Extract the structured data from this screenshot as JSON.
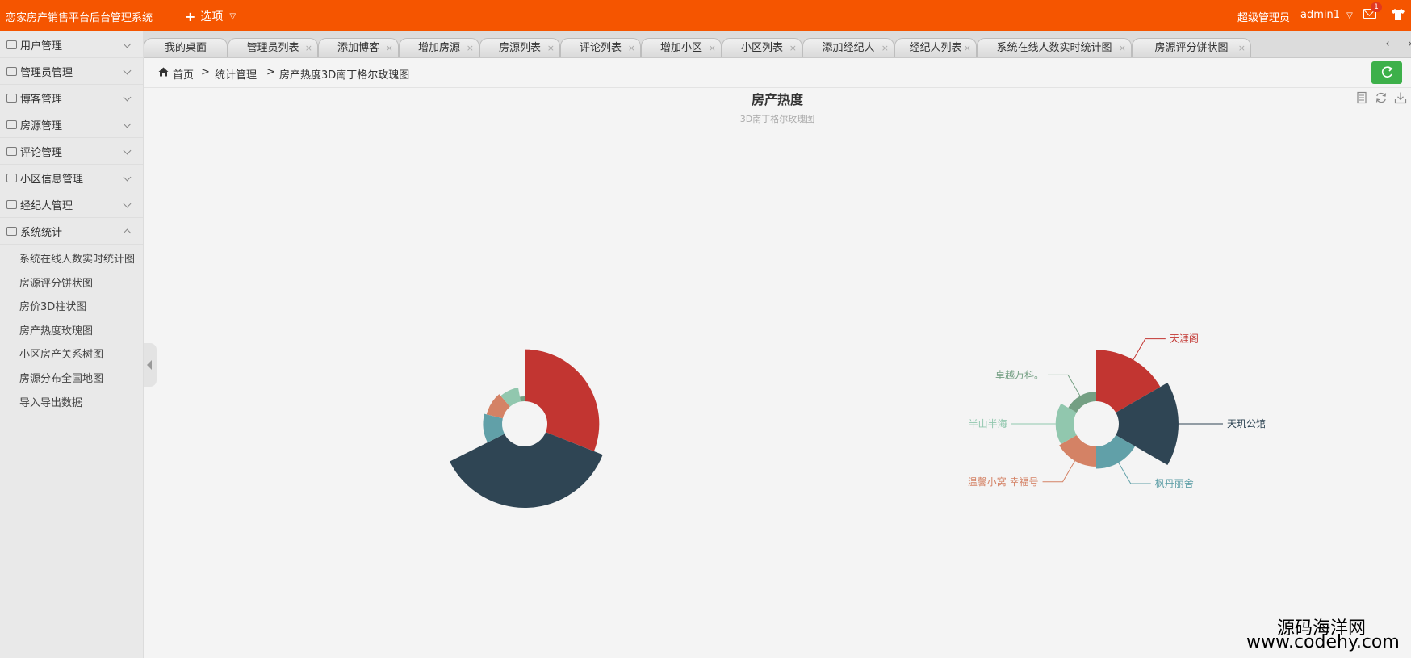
{
  "header": {
    "app_title": "恋家房产销售平台后台管理系统",
    "options_label": "选项",
    "role": "超级管理员",
    "username": "admin1",
    "mail_badge": "1"
  },
  "sidebar": {
    "menus": [
      {
        "label": "用户管理",
        "open": false
      },
      {
        "label": "管理员管理",
        "open": false
      },
      {
        "label": "博客管理",
        "open": false
      },
      {
        "label": "房源管理",
        "open": false
      },
      {
        "label": "评论管理",
        "open": false
      },
      {
        "label": "小区信息管理",
        "open": false
      },
      {
        "label": "经纪人管理",
        "open": false
      },
      {
        "label": "系统统计",
        "open": true
      }
    ],
    "submenu": [
      "系统在线人数实时统计图",
      "房源评分饼状图",
      "房价3D柱状图",
      "房产热度玫瑰图",
      "小区房产关系树图",
      "房源分布全国地图",
      "导入导出数据"
    ]
  },
  "tabs": [
    "我的桌面",
    "管理员列表",
    "添加博客",
    "增加房源",
    "房源列表",
    "评论列表",
    "增加小区",
    "小区列表",
    "添加经纪人",
    "经纪人列表",
    "系统在线人数实时统计图",
    "房源评分饼状图"
  ],
  "tab_close": "×",
  "tab_prev": "‹",
  "tab_next": "›",
  "breadcrumb": {
    "home": "首页",
    "sep1": ">",
    "level2": "统计管理",
    "sep2": ">",
    "current": "房产热度3D南丁格尔玫瑰图"
  },
  "chart_data": {
    "type": "pie",
    "variant": "nightingale-rose",
    "title": "房产热度",
    "subtitle": "3D南丁格尔玫瑰图",
    "legend": "none",
    "series": [
      {
        "name": "天涯阁",
        "color": "#c23531",
        "value": 22
      },
      {
        "name": "天玑公馆",
        "color": "#2f4554",
        "value": 26
      },
      {
        "name": "枫丹丽舍",
        "color": "#61a0a8",
        "value": 8
      },
      {
        "name": "温馨小窝 幸福号",
        "color": "#d48265",
        "value": 7
      },
      {
        "name": "半山半海",
        "color": "#91c7ae",
        "value": 6
      },
      {
        "name": "卓越万科。",
        "color": "#749f83",
        "value": 2
      }
    ]
  },
  "watermark": {
    "cn": "源码海洋网",
    "url": "www.codehy.com"
  }
}
